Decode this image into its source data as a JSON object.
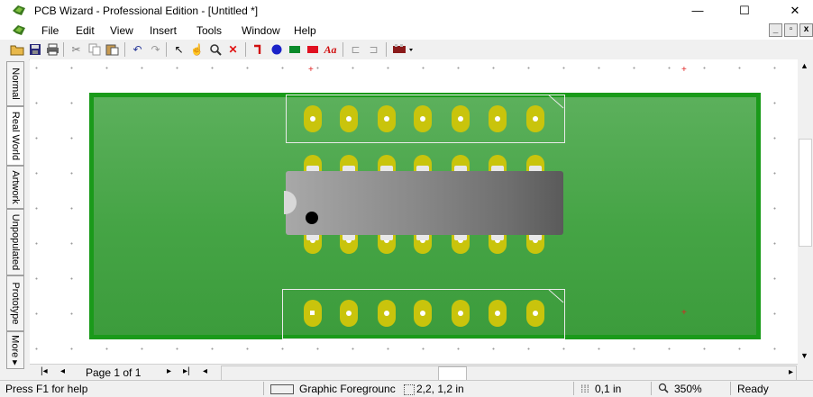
{
  "window": {
    "title": "PCB Wizard - Professional Edition - [Untitled *]",
    "minimize": "—",
    "maximize": "☐",
    "close": "✕"
  },
  "menu": {
    "items": [
      "File",
      "Edit",
      "View",
      "Insert",
      "Tools",
      "Window",
      "Help"
    ]
  },
  "toolbar": {
    "buttons": [
      {
        "name": "open-icon",
        "glyph": "📂"
      },
      {
        "name": "save-icon",
        "glyph": "💾"
      },
      {
        "name": "print-icon",
        "glyph": "🖶"
      },
      {
        "name": "cut-icon",
        "glyph": "✂"
      },
      {
        "name": "copy-icon",
        "glyph": "⎘"
      },
      {
        "name": "paste-icon",
        "glyph": "📋"
      },
      {
        "name": "undo-icon",
        "glyph": "↶"
      },
      {
        "name": "redo-icon",
        "glyph": "↷"
      },
      {
        "name": "select-pointer-icon",
        "glyph": "↖"
      },
      {
        "name": "pan-hand-icon",
        "glyph": "✋"
      },
      {
        "name": "zoom-icon",
        "glyph": "🔍"
      },
      {
        "name": "delete-icon",
        "glyph": "✕"
      },
      {
        "name": "track-icon",
        "glyph": "⌐"
      },
      {
        "name": "pad-icon",
        "glyph": "●"
      },
      {
        "name": "copper-rect-icon",
        "glyph": "■"
      },
      {
        "name": "red-rect-icon",
        "glyph": "■"
      },
      {
        "name": "text-icon",
        "glyph": "Aa"
      },
      {
        "name": "align-left-icon",
        "glyph": "⬚"
      },
      {
        "name": "align-right-icon",
        "glyph": "⬚"
      },
      {
        "name": "component-icon",
        "glyph": "▾"
      }
    ]
  },
  "sidebar": {
    "tabs": [
      "Normal",
      "Real World",
      "Artwork",
      "Unpopulated",
      "Prototype",
      "More ▸"
    ]
  },
  "colors": {
    "board_border": "#1a9a1a",
    "board_fill": "#45a445",
    "pad": "#c9c40c",
    "chip": "#8a8a8a"
  },
  "navigation": {
    "page_label": "Page 1 of 1"
  },
  "status": {
    "help": "Press F1 for help",
    "layer": "Graphic Foregrounc",
    "position": "2,2, 1,2 in",
    "grid": "0,1 in",
    "zoom": "350%",
    "state": "Ready"
  }
}
